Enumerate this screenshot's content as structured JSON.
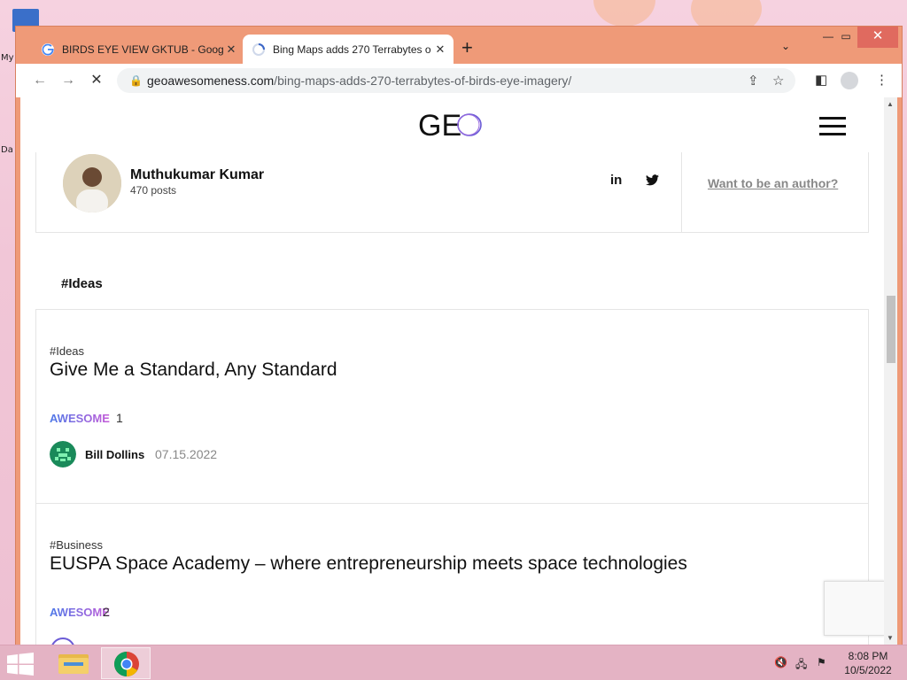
{
  "desktop": {
    "icon_labels": [
      "My",
      "Da"
    ]
  },
  "browser": {
    "tabs": [
      {
        "title": "BIRDS EYE VIEW GKTUB - Google",
        "active": false
      },
      {
        "title": "Bing Maps adds 270 Terrabytes o",
        "active": true
      }
    ],
    "new_tab": "+",
    "url_host": "geoawesomeness.com",
    "url_path": "/bing-maps-adds-270-terrabytes-of-birds-eye-imagery/"
  },
  "site": {
    "logo_text": "GE",
    "author": {
      "name": "Muthukumar Kumar",
      "posts": "470 posts",
      "linkedin": "in"
    },
    "want_author": "Want to be an author?",
    "tag_heading": "#Ideas",
    "articles": [
      {
        "tag": "#Ideas",
        "title": "Give Me a Standard, Any Standard",
        "badge": "AWESOME",
        "count": "1",
        "author": "Bill Dollins",
        "date": "07.15.2022"
      },
      {
        "tag": "#Business",
        "title": "EUSPA Space Academy – where entrepreneurship meets space technologies",
        "badge": "AWESOME",
        "count": "2",
        "author": "",
        "date": ""
      }
    ]
  },
  "taskbar": {
    "time": "8:08 PM",
    "date": "10/5/2022"
  },
  "colors": {
    "window_frame": "#ef9a78",
    "accent_gradient_start": "#4d79e8",
    "accent_gradient_end": "#c45ad8",
    "close_button": "#e06a5f"
  },
  "icons": [
    "google-favicon",
    "loading-favicon",
    "back-arrow",
    "forward-arrow",
    "stop-reload",
    "lock",
    "share",
    "star",
    "side-panel",
    "profile",
    "kebab-menu",
    "hamburger-menu",
    "linkedin",
    "twitter",
    "windows-start",
    "file-explorer",
    "chrome"
  ]
}
